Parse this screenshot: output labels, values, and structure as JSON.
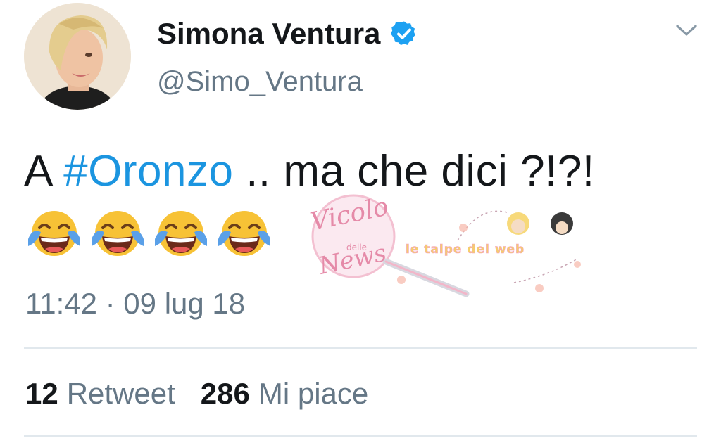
{
  "author": {
    "display_name": "Simona Ventura",
    "handle": "@Simo_Ventura",
    "verified_icon": "verified-badge-icon"
  },
  "tweet": {
    "text_prefix": "A ",
    "hashtag": "#Oronzo",
    "text_suffix": " .. ma che dici ?!?!",
    "emojis": [
      "😂",
      "😂",
      "😂",
      "😂"
    ],
    "timestamp": "11:42 · 09 lug 18"
  },
  "watermark": {
    "brand_lines": [
      "Vicolo",
      "delle",
      "News"
    ],
    "tagline": "le talpe del web"
  },
  "stats": {
    "retweets_count": "12",
    "retweets_label": "Retweet",
    "likes_count": "286",
    "likes_label": "Mi piace"
  },
  "colors": {
    "link": "#1b95e0",
    "secondary_text": "#657786",
    "verified": "#1da1f2"
  }
}
